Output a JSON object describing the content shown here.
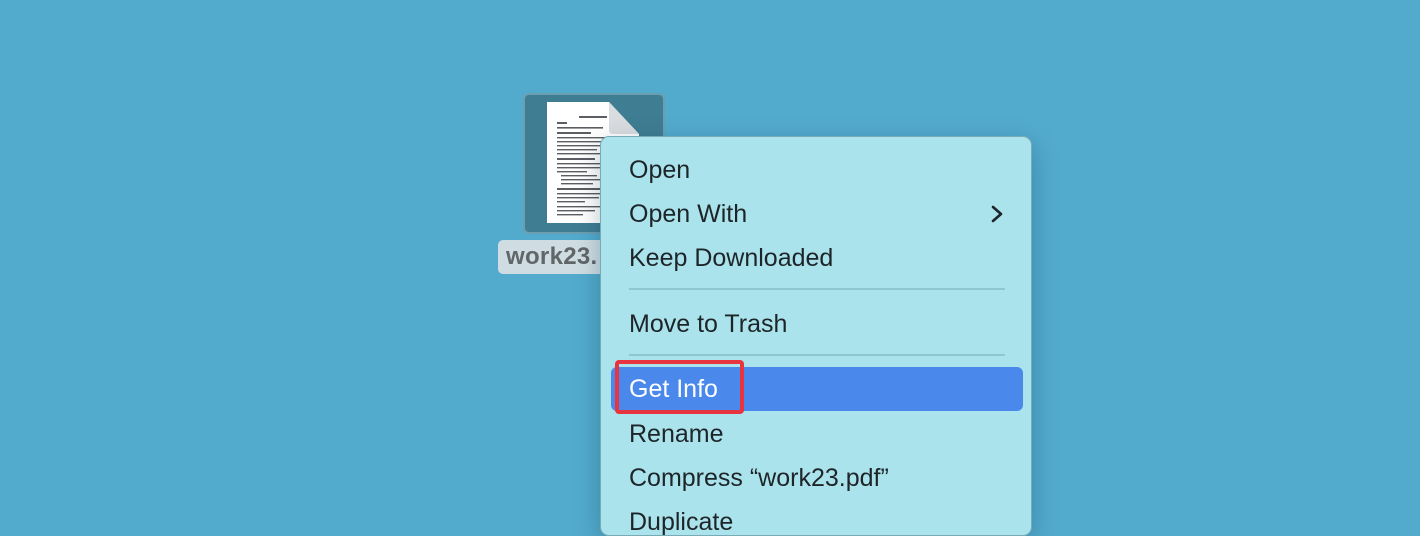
{
  "desktop": {
    "background_color": "#52abcd",
    "file": {
      "icon": "pdf-document-icon",
      "label": "work23."
    }
  },
  "context_menu": {
    "items": [
      {
        "label": "Open"
      },
      {
        "label": "Open With",
        "icon": "chevron-right-icon"
      },
      {
        "label": "Keep Downloaded"
      },
      {
        "label": "Move to Trash"
      },
      {
        "label": "Get Info",
        "selected": true
      },
      {
        "label": "Rename"
      },
      {
        "label": "Compress “work23.pdf”"
      },
      {
        "label": "Duplicate"
      }
    ],
    "selection_color": "#4a88ec"
  },
  "annotation": {
    "color": "#e8343f",
    "target": "Get Info"
  }
}
